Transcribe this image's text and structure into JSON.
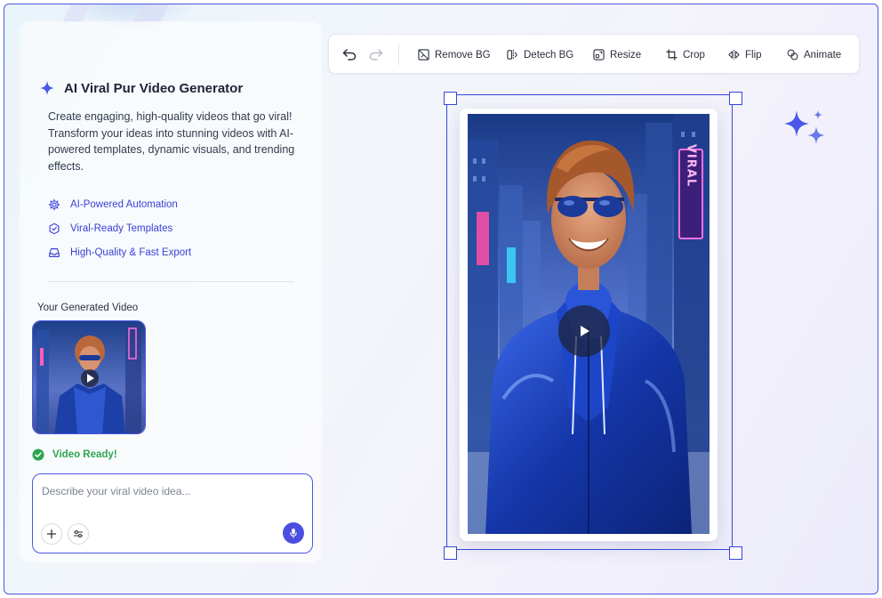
{
  "app": {
    "title": "AI Viral Pur Video Generator",
    "description": "Create engaging, high-quality videos that go viral! Transform your ideas into stunning videos with AI-powered templates, dynamic visuals, and trending effects.",
    "features": [
      {
        "label": "AI-Powered Automation",
        "icon": "gear-icon"
      },
      {
        "label": "Viral-Ready Templates",
        "icon": "template-badge-icon"
      },
      {
        "label": "High-Quality & Fast Export",
        "icon": "export-tray-icon"
      }
    ]
  },
  "generated": {
    "section_label": "Your Generated Video",
    "status": "Video Ready!"
  },
  "prompt": {
    "placeholder": "Describe your viral video idea..."
  },
  "toolbar": {
    "remove_bg": "Remove BG",
    "detech_bg": "Detech BG",
    "resize": "Resize",
    "crop": "Crop",
    "flip": "Flip",
    "animate": "Animate"
  },
  "image_text": {
    "sign_viral": "VIRAL"
  },
  "colors": {
    "accent": "#4b4fe0",
    "selection": "#3845d8",
    "success": "#2ea44f",
    "feature_text": "#3b3fd6"
  }
}
